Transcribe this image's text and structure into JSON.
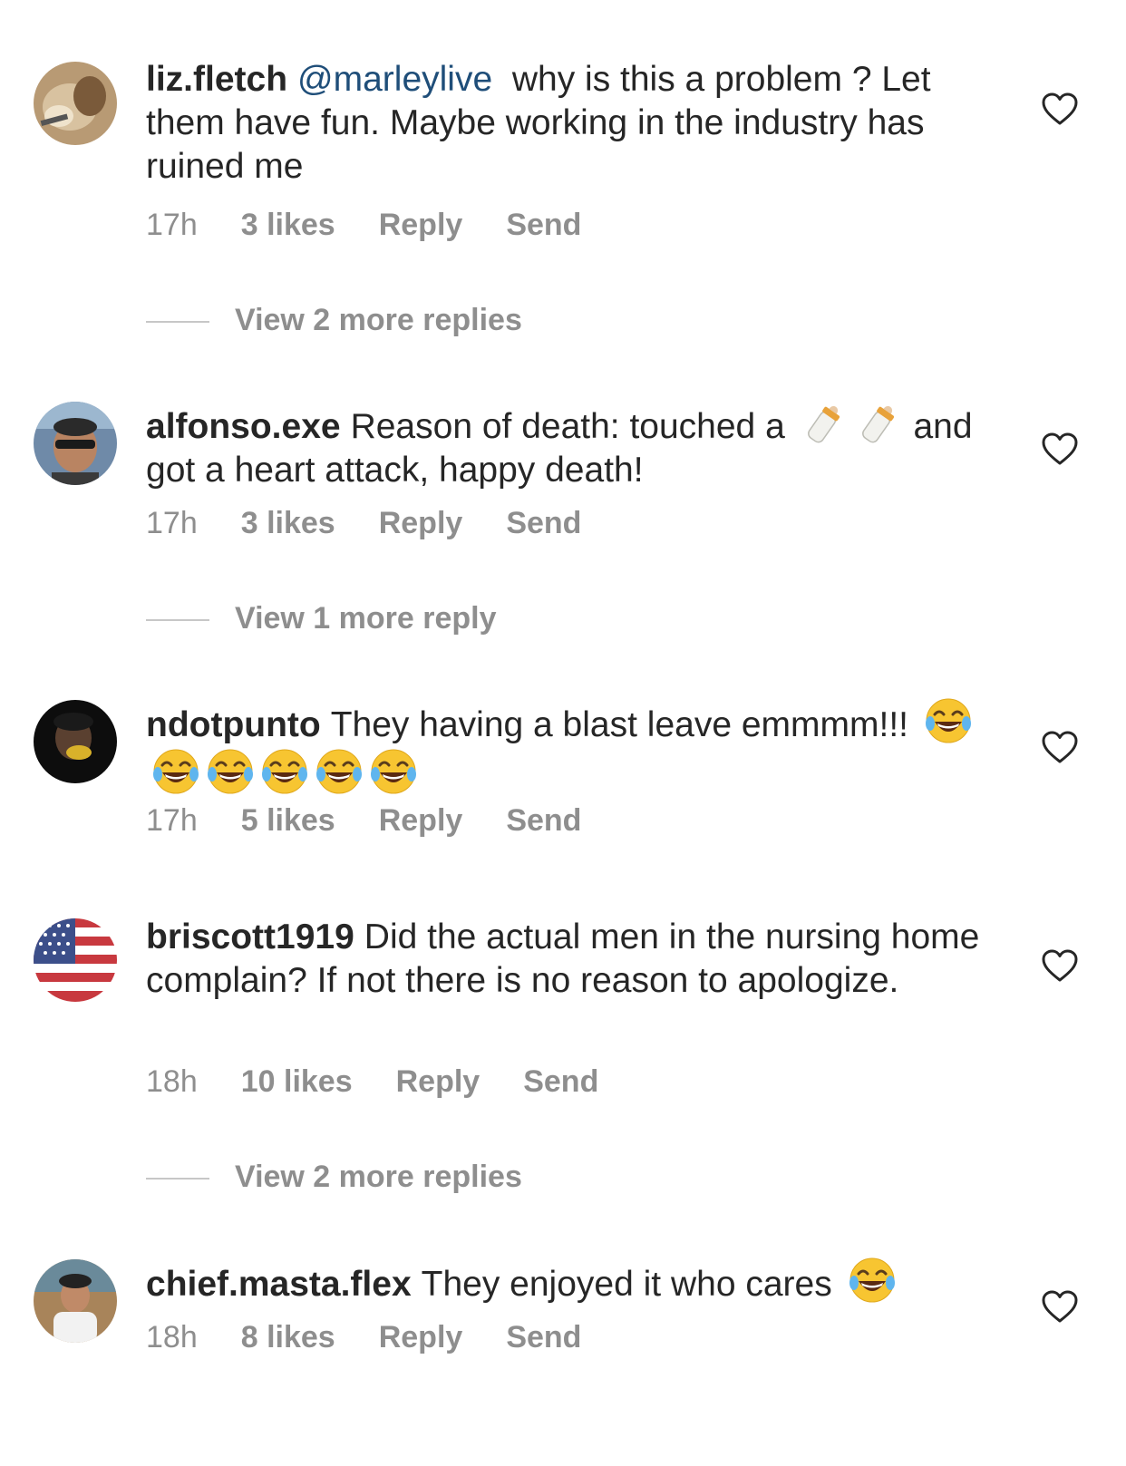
{
  "comments": [
    {
      "username": "liz.fletch",
      "mention": "@marleylive",
      "text": "why is this a problem ? Let them have fun. Maybe working in the industry has ruined me",
      "time": "17h",
      "likes": "3 likes",
      "reply": "Reply",
      "send": "Send",
      "more_replies": "View 2 more replies"
    },
    {
      "username": "alfonso.exe",
      "text_before": "Reason of death: touched a",
      "emojis": [
        "baby-bottle-emoji",
        "baby-bottle-emoji"
      ],
      "text_after": "and got a heart attack, happy death!",
      "time": "17h",
      "likes": "3 likes",
      "reply": "Reply",
      "send": "Send",
      "more_replies": "View 1 more reply"
    },
    {
      "username": "ndotpunto",
      "text": "They having a blast leave emmmm!!!",
      "emojis": [
        "laughing-tears-emoji",
        "laughing-tears-emoji",
        "laughing-tears-emoji",
        "laughing-tears-emoji",
        "laughing-tears-emoji",
        "laughing-tears-emoji"
      ],
      "time": "17h",
      "likes": "5 likes",
      "reply": "Reply",
      "send": "Send"
    },
    {
      "username": "briscott1919",
      "text": "Did the actual men in the nursing home complain?  If not there is no reason to apologize.",
      "time": "18h",
      "likes": "10 likes",
      "reply": "Reply",
      "send": "Send",
      "more_replies": "View 2 more replies"
    },
    {
      "username": "chief.masta.flex",
      "text": "They enjoyed it who cares",
      "emojis": [
        "laughing-tears-emoji"
      ],
      "time": "18h",
      "likes": "8 likes",
      "reply": "Reply",
      "send": "Send"
    }
  ],
  "colors": {
    "text": "#262626",
    "meta": "#8e8e8e",
    "mention": "#1f4e79",
    "divider": "#c7c7c7"
  }
}
